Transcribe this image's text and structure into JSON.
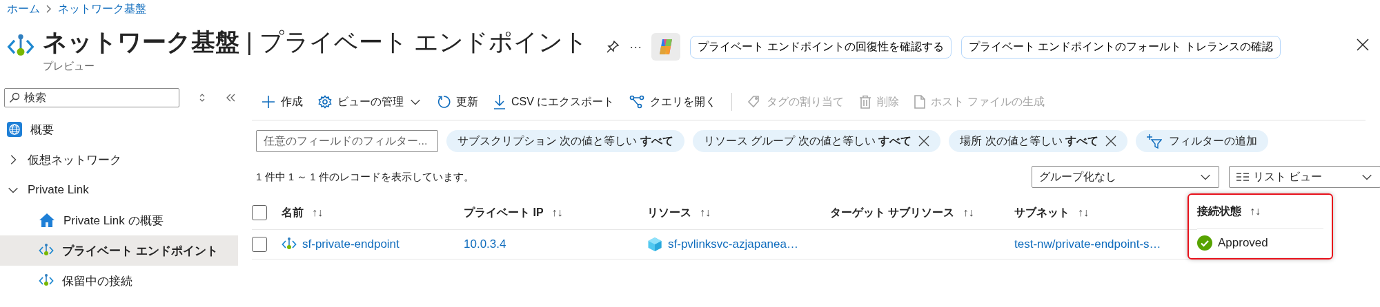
{
  "breadcrumb": [
    {
      "label": "ホーム"
    },
    {
      "label": "ネットワーク基盤"
    }
  ],
  "header": {
    "title": "**ネットワーク基盤** | プライベート エンドポイント",
    "subtitle": "プレビュー",
    "more": "···",
    "suggestions": [
      {
        "label": "プライベート エンドポイントの回復性を確認する"
      },
      {
        "label": "プライベート エンドポイントのフォールト トレランスの確認"
      }
    ]
  },
  "sidebar": {
    "search_placeholder": "検索",
    "items": [
      {
        "label": "概要",
        "kind": "page",
        "selected": false
      },
      {
        "label": "仮想ネットワーク",
        "kind": "group",
        "expanded": false,
        "selected": false
      },
      {
        "label": "Private Link",
        "kind": "group",
        "expanded": true,
        "selected": false,
        "children": [
          {
            "label": "Private Link の概要",
            "kind": "home",
            "selected": false
          },
          {
            "label": "プライベート エンドポイント",
            "kind": "endpoint",
            "selected": true
          },
          {
            "label": "保留中の接続",
            "kind": "endpoint",
            "selected": false
          }
        ]
      }
    ]
  },
  "toolbar": {
    "actions": [
      {
        "label": "作成",
        "kind": "create",
        "disabled": false
      },
      {
        "label": "ビューの管理",
        "kind": "manage",
        "disabled": false
      },
      {
        "label": "更新",
        "kind": "refresh",
        "disabled": false
      },
      {
        "label": "CSV にエクスポート",
        "kind": "export",
        "disabled": false
      },
      {
        "label": "クエリを開く",
        "kind": "query",
        "disabled": false
      }
    ],
    "secondary_actions": [
      {
        "label": "タグの割り当て",
        "kind": "tag",
        "disabled": true
      },
      {
        "label": "削除",
        "kind": "delete",
        "disabled": true
      },
      {
        "label": "ホスト ファイルの生成",
        "kind": "file",
        "disabled": true
      }
    ]
  },
  "filters": {
    "placeholder": "任意のフィールドのフィルター...",
    "chips": [
      {
        "text": "サブスクリプション 次の値と等しい **すべて**",
        "closable": false
      },
      {
        "text": "リソース グループ 次の値と等しい **すべて**",
        "closable": true
      },
      {
        "text": "場所 次の値と等しい **すべて**",
        "closable": true
      }
    ],
    "add_filter": "フィルターの追加"
  },
  "records": "1 件中 1 ～ 1 件のレコードを表示しています。",
  "grouping": {
    "value": "グループ化なし"
  },
  "view": {
    "value": "リスト ビュー"
  },
  "table": {
    "select_all_checked": false,
    "columns": [
      {
        "label": "名前",
        "sort": "↑↓",
        "highlighted": false
      },
      {
        "label": "プライベート IP",
        "sort": "↑↓",
        "highlighted": false
      },
      {
        "label": "リソース",
        "sort": "↑↓",
        "highlighted": false
      },
      {
        "label": "ターゲット サブリソース",
        "sort": "↑↓",
        "highlighted": false
      },
      {
        "label": "サブネット",
        "sort": "↑↓",
        "highlighted": false
      },
      {
        "label": "接続状態",
        "sort": "↑↓",
        "highlighted": true
      }
    ],
    "rows": [
      {
        "checked": false,
        "name": "sf-private-endpoint",
        "private_ip": "10.0.3.4",
        "resource": "sf-pvlinksvc-azjapanea…",
        "subnet": "test-nw/private-endpoint-s…",
        "status": "Approved"
      }
    ]
  }
}
